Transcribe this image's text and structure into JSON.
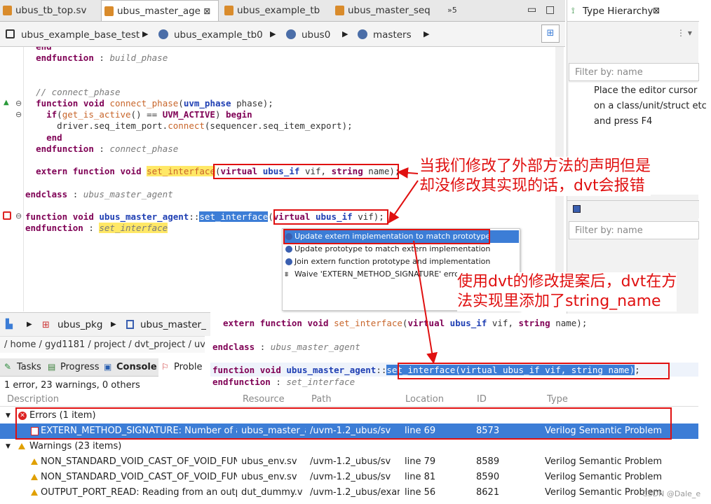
{
  "editor_tabs": [
    {
      "label": "ubus_tb_top.sv",
      "active": false
    },
    {
      "label": "ubus_master_age",
      "active": true,
      "close": "⊠"
    },
    {
      "label": "ubus_example_tb",
      "active": false
    },
    {
      "label": "ubus_master_seq",
      "active": false
    },
    {
      "label": "»5",
      "active": false
    }
  ],
  "breadcrumb": [
    "ubus_example_base_test",
    "ubus_example_tb0",
    "ubus0",
    "masters"
  ],
  "code_lines": [
    {
      "indent": "  ",
      "parts": [
        [
          "kw",
          "end"
        ]
      ]
    },
    {
      "indent": "  ",
      "parts": [
        [
          "kw",
          "endfunction"
        ],
        [
          "id",
          " : "
        ],
        [
          "cm",
          "build_phase"
        ]
      ]
    },
    {
      "indent": "",
      "parts": []
    },
    {
      "indent": "",
      "parts": []
    },
    {
      "indent": "  ",
      "parts": [
        [
          "cm",
          "// connect_phase"
        ]
      ]
    },
    {
      "indent": "  ",
      "parts": [
        [
          "kw",
          "function"
        ],
        [
          "id",
          " "
        ],
        [
          "kw",
          "void"
        ],
        [
          "id",
          " "
        ],
        [
          "fn",
          "connect_phase"
        ],
        [
          "id",
          "("
        ],
        [
          "ty",
          "uvm_phase"
        ],
        [
          "id",
          " phase);"
        ]
      ]
    },
    {
      "indent": "    ",
      "parts": [
        [
          "kw",
          "if"
        ],
        [
          "id",
          "("
        ],
        [
          "fn",
          "get_is_active"
        ],
        [
          "id",
          "() == "
        ],
        [
          "kw",
          "UVM_ACTIVE"
        ],
        [
          "id",
          ") "
        ],
        [
          "kw",
          "begin"
        ]
      ]
    },
    {
      "indent": "     ",
      "parts": [
        [
          "id",
          " driver.seq_item_port."
        ],
        [
          "fn",
          "connect"
        ],
        [
          "id",
          "(sequencer.seq_item_export);"
        ]
      ]
    },
    {
      "indent": "    ",
      "parts": [
        [
          "kw",
          "end"
        ]
      ]
    },
    {
      "indent": "  ",
      "parts": [
        [
          "kw",
          "endfunction"
        ],
        [
          "id",
          " : "
        ],
        [
          "cm",
          "connect_phase"
        ]
      ]
    },
    {
      "indent": "",
      "parts": []
    },
    {
      "indent": "  ",
      "parts": [
        [
          "kw",
          "extern"
        ],
        [
          "id",
          " "
        ],
        [
          "kw",
          "function"
        ],
        [
          "id",
          " "
        ],
        [
          "kw",
          "void"
        ],
        [
          "id",
          " "
        ],
        [
          "fnh",
          "set_interface"
        ],
        [
          "id",
          "("
        ],
        [
          "kw",
          "virtual"
        ],
        [
          "id",
          " "
        ],
        [
          "ty",
          "ubus_if"
        ],
        [
          "id",
          " vif, "
        ],
        [
          "kw",
          "string"
        ],
        [
          "id",
          " name);"
        ]
      ]
    },
    {
      "indent": "",
      "parts": []
    },
    {
      "indent": "",
      "parts": [
        [
          "kw",
          "endclass"
        ],
        [
          "id",
          " : "
        ],
        [
          "cm",
          "ubus_master_agent"
        ]
      ]
    },
    {
      "indent": "",
      "parts": []
    },
    {
      "indent": "",
      "parts": [
        [
          "kw",
          "function"
        ],
        [
          "id",
          " "
        ],
        [
          "kw",
          "void"
        ],
        [
          "id",
          " "
        ],
        [
          "ty",
          "ubus_master_agent"
        ],
        [
          "id",
          "::"
        ],
        [
          "sel",
          "set_interface"
        ],
        [
          "id",
          "("
        ],
        [
          "kw",
          "virtual"
        ],
        [
          "id",
          " "
        ],
        [
          "ty",
          "ubus_if"
        ],
        [
          "id",
          " vif);"
        ]
      ]
    },
    {
      "indent": "",
      "parts": [
        [
          "kw",
          "endfunction"
        ],
        [
          "id",
          " : "
        ],
        [
          "cmh",
          "set_interface"
        ]
      ]
    }
  ],
  "quickfix": [
    "Update extern implementation to match prototype",
    "Update prototype to match extern implementation",
    "Join extern function prototype and implementation",
    "Waive 'EXTERN_METHOD_SIGNATURE' error"
  ],
  "type_hierarchy": {
    "title": "Type Hierarchy",
    "filter_placeholder": "Filter by: name",
    "hint": [
      "Place the editor cursor",
      "on a class/unit/struct etc",
      "and press F4"
    ],
    "filter2_placeholder": "Filter by: name"
  },
  "lower_breadcrumb": [
    "ubus_pkg",
    "ubus_master_"
  ],
  "path_bar": "/ home / gyd1181 / project / dvt_project / uvm",
  "bottom_tabs": [
    "Tasks",
    "Progress",
    "Console",
    "Proble"
  ],
  "problems_summary": "1 error, 23 warnings, 0 others",
  "columns": [
    "Description",
    "Resource",
    "Path",
    "Location",
    "ID",
    "Type"
  ],
  "errors_group": "Errors (1 item)",
  "warnings_group": "Warnings (23 items)",
  "rows": [
    {
      "kind": "error",
      "desc": "EXTERN_METHOD_SIGNATURE: Number of ar",
      "res": "ubus_master_a",
      "path": "/uvm-1.2_ubus/sv",
      "loc": "line 69",
      "id": "8573",
      "type": "Verilog Semantic Problem"
    },
    {
      "kind": "warn",
      "desc": "NON_STANDARD_VOID_CAST_OF_VOID_FUN(",
      "res": "ubus_env.sv",
      "path": "/uvm-1.2_ubus/sv",
      "loc": "line 79",
      "id": "8589",
      "type": "Verilog Semantic Problem"
    },
    {
      "kind": "warn",
      "desc": "NON_STANDARD_VOID_CAST_OF_VOID_FUN(",
      "res": "ubus_env.sv",
      "path": "/uvm-1.2_ubus/sv",
      "loc": "line 81",
      "id": "8590",
      "type": "Verilog Semantic Problem"
    },
    {
      "kind": "warn",
      "desc": "OUTPUT_PORT_READ: Reading from an outpu",
      "res": "dut_dummy.v",
      "path": "/uvm-1.2_ubus/exar",
      "loc": "line 56",
      "id": "8621",
      "type": "Verilog Semantic Problem"
    }
  ],
  "overlay_code": {
    "line1": [
      [
        "kw",
        "extern"
      ],
      [
        "id",
        " "
      ],
      [
        "kw",
        "function"
      ],
      [
        "id",
        " "
      ],
      [
        "kw",
        "void"
      ],
      [
        "id",
        " "
      ],
      [
        "fn",
        "set_interface"
      ],
      [
        "id",
        "("
      ],
      [
        "kw",
        "virtual"
      ],
      [
        "id",
        " "
      ],
      [
        "ty",
        "ubus_if"
      ],
      [
        "id",
        " vif, "
      ],
      [
        "kw",
        "string"
      ],
      [
        "id",
        " name);"
      ]
    ],
    "line2": [
      [
        "kw",
        "endclass"
      ],
      [
        "id",
        " : "
      ],
      [
        "cm",
        "ubus_master_agent"
      ]
    ],
    "line3": [
      [
        "kw",
        "function"
      ],
      [
        "id",
        " "
      ],
      [
        "kw",
        "void"
      ],
      [
        "id",
        " "
      ],
      [
        "ty",
        "ubus_master_agent"
      ],
      [
        "id",
        "::"
      ],
      [
        "sel",
        "set_interface(virtual ubus_if vif, string name)"
      ],
      [
        "id",
        ";"
      ]
    ],
    "line4": [
      [
        "kw",
        "endfunction"
      ],
      [
        "id",
        " : "
      ],
      [
        "cm",
        "set_interface"
      ]
    ]
  },
  "annotation1": [
    "当我们修改了外部方法的声明但是",
    "却没修改其实现的话，dvt会报错"
  ],
  "annotation2": [
    "使用dvt的修改提案后，dvt在方",
    "法实现里添加了string_name"
  ],
  "watermark": "CSDN @Dale_e",
  "colors": {
    "accent": "#3c7dd6",
    "annotation": "#e01010",
    "selection_row": "#3c7dd6"
  }
}
